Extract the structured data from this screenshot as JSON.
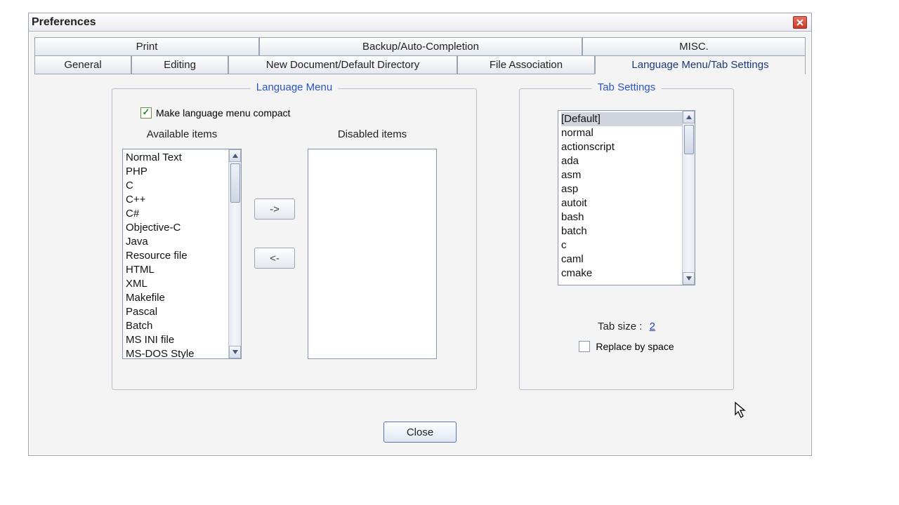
{
  "window": {
    "title": "Preferences"
  },
  "tabs_top": [
    "Print",
    "Backup/Auto-Completion",
    "MISC."
  ],
  "tabs_bottom": [
    "General",
    "Editing",
    "New Document/Default Directory",
    "File Association",
    "Language Menu/Tab Settings"
  ],
  "lang_group": {
    "legend": "Language Menu",
    "compact_label": "Make language menu compact",
    "compact_checked": true,
    "available_label": "Available items",
    "disabled_label": "Disabled items",
    "available_items": [
      "Normal Text",
      "PHP",
      "C",
      "C++",
      "C#",
      "Objective-C",
      "Java",
      "Resource file",
      "HTML",
      "XML",
      "Makefile",
      "Pascal",
      "Batch",
      "MS INI file",
      "MS-DOS Style"
    ],
    "move_right_label": "->",
    "move_left_label": "<-"
  },
  "tab_group": {
    "legend": "Tab Settings",
    "items": [
      "[Default]",
      "normal",
      "actionscript",
      "ada",
      "asm",
      "asp",
      "autoit",
      "bash",
      "batch",
      "c",
      "caml",
      "cmake"
    ],
    "selected_index": 0,
    "tab_size_label": "Tab size :",
    "tab_size_value": "2",
    "replace_label": "Replace by space",
    "replace_checked": false
  },
  "footer": {
    "close_label": "Close"
  }
}
